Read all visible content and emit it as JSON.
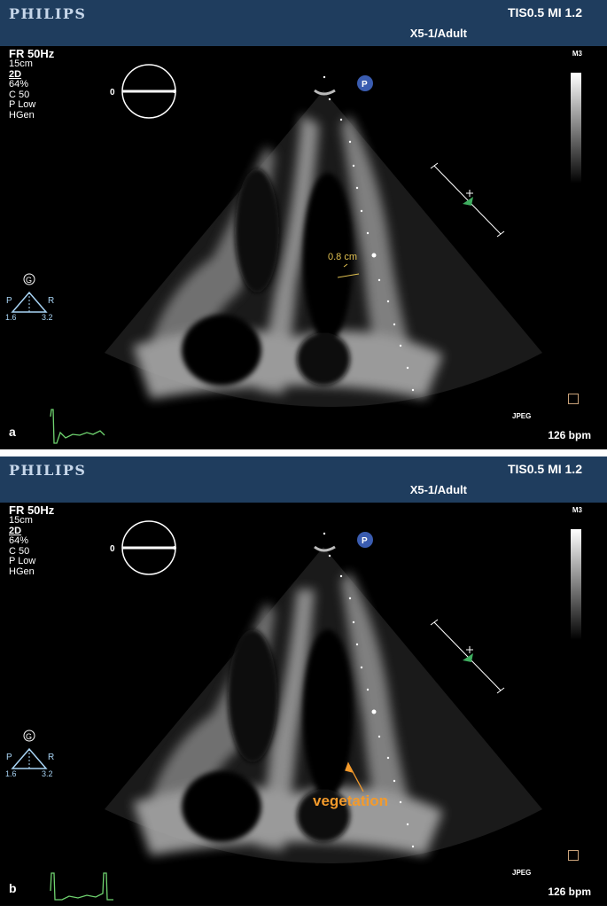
{
  "panels": [
    {
      "brand": "PHILIPS",
      "tis_mi": "TIS0.5   MI 1.2",
      "probe": "X5-1/Adult",
      "m3": "M3",
      "frame_rate": "FR 50Hz",
      "depth": "15cm",
      "mode": "2D",
      "gain": "64%",
      "compression": "C 50",
      "power": "P Low",
      "harmonic": "HGen",
      "angle": "0",
      "orient_p": "P",
      "orient_r": "R",
      "orient_left": "1.6",
      "orient_right": "3.2",
      "orient_g": "G",
      "marker_p": "P",
      "jpeg": "JPEG",
      "heart_rate": "126 bpm",
      "label": "a",
      "measurement": "0.8 cm"
    },
    {
      "brand": "PHILIPS",
      "tis_mi": "TIS0.5   MI 1.2",
      "probe": "X5-1/Adult",
      "m3": "M3",
      "frame_rate": "FR 50Hz",
      "depth": "15cm",
      "mode": "2D",
      "gain": "64%",
      "compression": "C 50",
      "power": "P Low",
      "harmonic": "HGen",
      "angle": "0",
      "orient_p": "P",
      "orient_r": "R",
      "orient_left": "1.6",
      "orient_right": "3.2",
      "orient_g": "G",
      "marker_p": "P",
      "jpeg": "JPEG",
      "heart_rate": "126 bpm",
      "label": "b",
      "annotation": "vegetation"
    }
  ],
  "colors": {
    "header": "#1f3d5e",
    "ecg": "#6fd36f",
    "measurement": "#e0c050",
    "annotation": "#f39a2b"
  }
}
